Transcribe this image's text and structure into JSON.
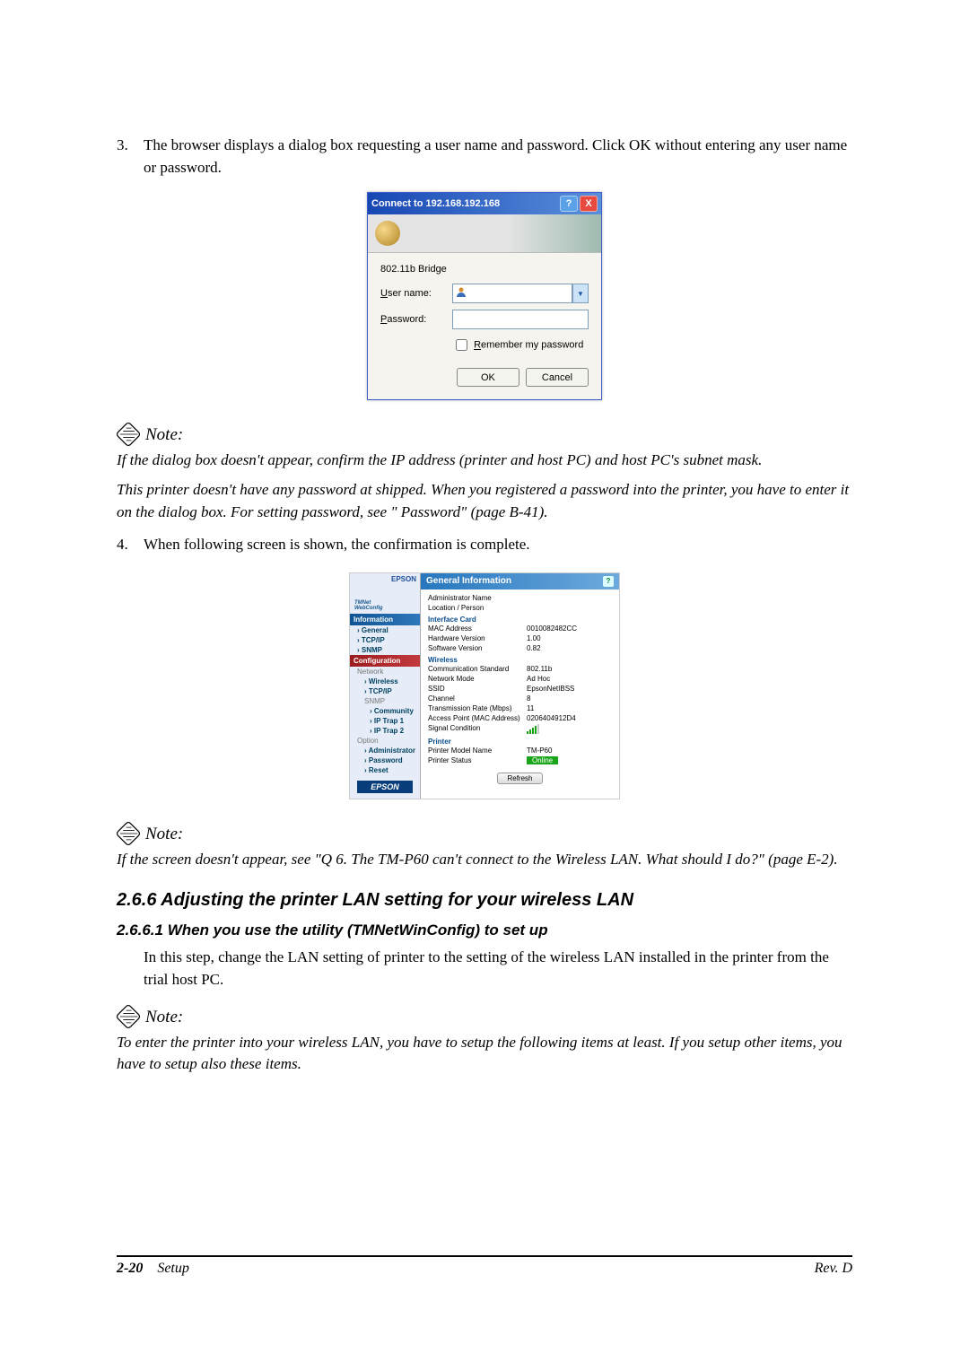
{
  "step3": {
    "num": "3.",
    "text": "The browser displays a dialog box requesting a user name and password. Click OK without entering any user name or password."
  },
  "dialog": {
    "title": "Connect to 192.168.192.168",
    "help_btn": "?",
    "close_btn": "X",
    "realm": "802.11b Bridge",
    "user_label": "User name:",
    "user_value": "",
    "pass_label": "Password:",
    "pass_value": "",
    "remember": "Remember my password",
    "ok": "OK",
    "cancel": "Cancel"
  },
  "note1": {
    "label": "Note:",
    "para1": "If the dialog box doesn't appear, confirm the IP address (printer and host PC) and host PC's subnet mask.",
    "para2": "This printer doesn't have any password at shipped. When you registered a password into the printer, you have to enter it on the dialog box. For setting password, see \" Password\" (page B-41)."
  },
  "step4": {
    "num": "4.",
    "text": "When following screen is shown, the confirmation is complete."
  },
  "gi": {
    "logo_text": "EPSON",
    "brand1": "TMNet",
    "brand2": "WebConfig",
    "sec_info": "Information",
    "nav_general": "General",
    "nav_tcpip": "TCP/IP",
    "nav_snmp": "SNMP",
    "sec_config": "Configuration",
    "nav_network": "Network",
    "nav_wireless": "Wireless",
    "nav_tcpip2": "TCP/IP",
    "nav_snmp2": "SNMP",
    "nav_community": "Community",
    "nav_trap1": "IP Trap 1",
    "nav_trap2": "IP Trap 2",
    "nav_option": "Option",
    "nav_admin": "Administrator",
    "nav_password": "Password",
    "nav_reset": "Reset",
    "epson_btn": "EPSON",
    "title": "General Information",
    "help_btn": "?",
    "r_admin_name_l": "Administrator Name",
    "r_admin_name_v": "",
    "r_loc_l": "Location / Person",
    "r_loc_v": "",
    "grp_card": "Interface Card",
    "r_mac_l": "MAC Address",
    "r_mac_v": "0010082482CC",
    "r_hw_l": "Hardware Version",
    "r_hw_v": "1.00",
    "r_sw_l": "Software Version",
    "r_sw_v": "0.82",
    "grp_wireless": "Wireless",
    "r_std_l": "Communication Standard",
    "r_std_v": "802.11b",
    "r_mode_l": "Network Mode",
    "r_mode_v": "Ad Hoc",
    "r_ssid_l": "SSID",
    "r_ssid_v": "EpsonNetIBSS",
    "r_ch_l": "Channel",
    "r_ch_v": "8",
    "r_rate_l": "Transmission Rate (Mbps)",
    "r_rate_v": "11",
    "r_ap_l": "Access Point (MAC Address)",
    "r_ap_v": "0206404912D4",
    "r_sig_l": "Signal Condition",
    "grp_printer": "Printer",
    "r_model_l": "Printer Model Name",
    "r_model_v": "TM-P60",
    "r_stat_l": "Printer Status",
    "r_stat_v": "Online",
    "refresh": "Refresh"
  },
  "note2": {
    "label": "Note:",
    "para1": "If the screen doesn't appear, see \"Q 6. The TM-P60 can't connect to the Wireless LAN. What should I do?\" (page E-2)."
  },
  "h266": "2.6.6  Adjusting the printer LAN setting for your wireless LAN",
  "h2661": "2.6.6.1  When you use the utility (TMNetWinConfig) to set up",
  "body_para1": "In this step, change the LAN setting of printer to the setting of the wireless LAN installed in the printer from the trial host PC.",
  "note3": {
    "label": "Note:",
    "para1": "To enter the printer into your wireless LAN, you have to setup the following items at least. If you setup other items, you have to setup also these items."
  },
  "footer": {
    "page": "2-20",
    "section": "Setup",
    "rev": "Rev. D"
  }
}
